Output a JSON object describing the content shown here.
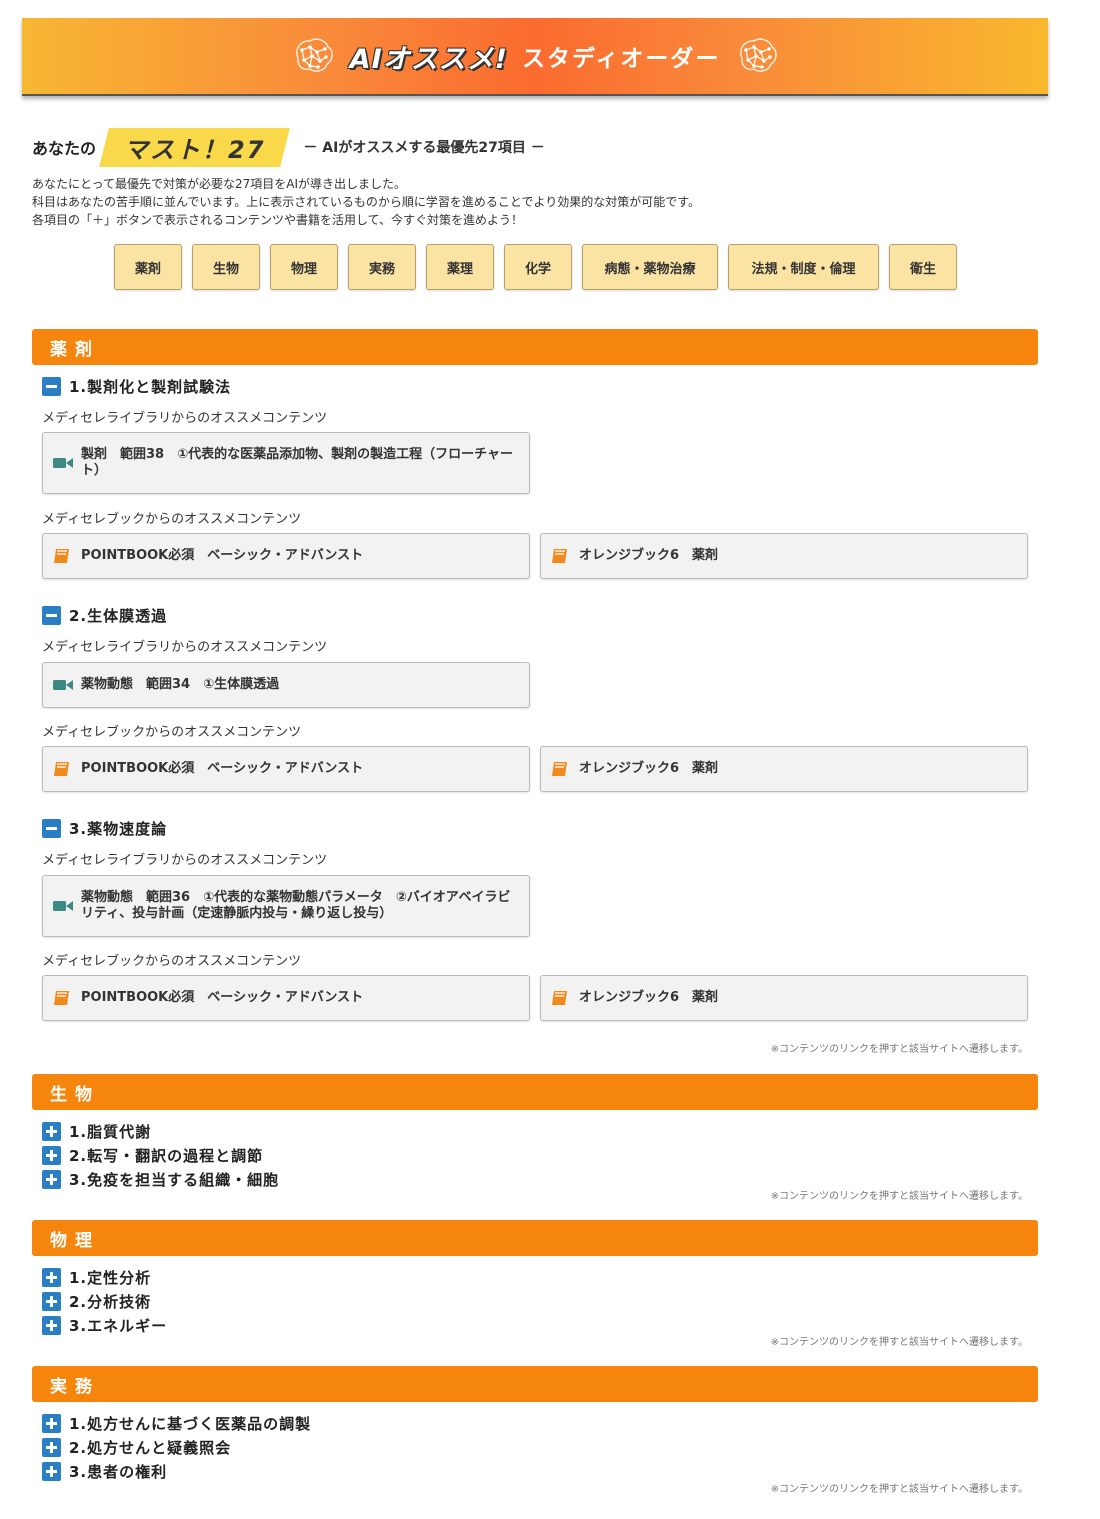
{
  "banner": {
    "title": "AIオススメ!",
    "subtitle": "スタディオーダー"
  },
  "must": {
    "prefix": "あなたの",
    "badge": "マスト！27",
    "tagline": "－ AIがオススメする最優先27項目 －"
  },
  "intro": [
    "あなたにとって最優先で対策が必要な27項目をAIが導き出しました。",
    "科目はあなたの苦手順に並んでいます。上に表示されているものから順に学習を進めることでより効果的な対策が可能です。",
    "各項目の「＋」ボタンで表示されるコンテンツや書籍を活用して、今すぐ対策を進めよう！"
  ],
  "subjects": [
    "薬剤",
    "生物",
    "物理",
    "実務",
    "薬理",
    "化学",
    "病態・薬物治療",
    "法規・制度・倫理",
    "衛生"
  ],
  "labels": {
    "library": "メディセレライブラリからのオススメコンテンツ",
    "book": "メディセレブックからのオススメコンテンツ",
    "note": "※コンテンツのリンクを押すと該当サイトへ遷移します。"
  },
  "sections": {
    "yakuzai": {
      "title": "薬剤",
      "items": [
        {
          "title": "1.製剤化と製剤試験法",
          "video": "製剤　範囲38　①代表的な医薬品添加物、製剤の製造工程（フローチャート）",
          "book1": "POINTBOOK必須　ベーシック・アドバンスト",
          "book2": "オレンジブック6　薬剤"
        },
        {
          "title": "2.生体膜透過",
          "video": "薬物動態　範囲34　①生体膜透過",
          "book1": "POINTBOOK必須　ベーシック・アドバンスト",
          "book2": "オレンジブック6　薬剤"
        },
        {
          "title": "3.薬物速度論",
          "video": "薬物動態　範囲36　①代表的な薬物動態パラメータ　②バイオアベイラビリティ、投与計画（定速静脈内投与・繰り返し投与）",
          "book1": "POINTBOOK必須　ベーシック・アドバンスト",
          "book2": "オレンジブック6　薬剤"
        }
      ]
    },
    "seibutsu": {
      "title": "生物",
      "items": [
        "1.脂質代謝",
        "2.転写・翻訳の過程と調節",
        "3.免疫を担当する組織・細胞"
      ]
    },
    "butsuri": {
      "title": "物理",
      "items": [
        "1.定性分析",
        "2.分析技術",
        "3.エネルギー"
      ]
    },
    "jitsumu": {
      "title": "実務",
      "items": [
        "1.処方せんに基づく医薬品の調製",
        "2.処方せんと疑義照会",
        "3.患者の権利"
      ]
    }
  },
  "colors": {
    "section_bar": "#f5850c",
    "toggle": "#2a7fc4",
    "subject_button": "#fbe3a4",
    "must_badge": "#f9d94a"
  },
  "icons": {
    "video": "video-camera-icon",
    "book": "book-icon",
    "brain": "brain-network-icon",
    "expanded": "minus-square-icon",
    "collapsed": "plus-square-icon"
  }
}
